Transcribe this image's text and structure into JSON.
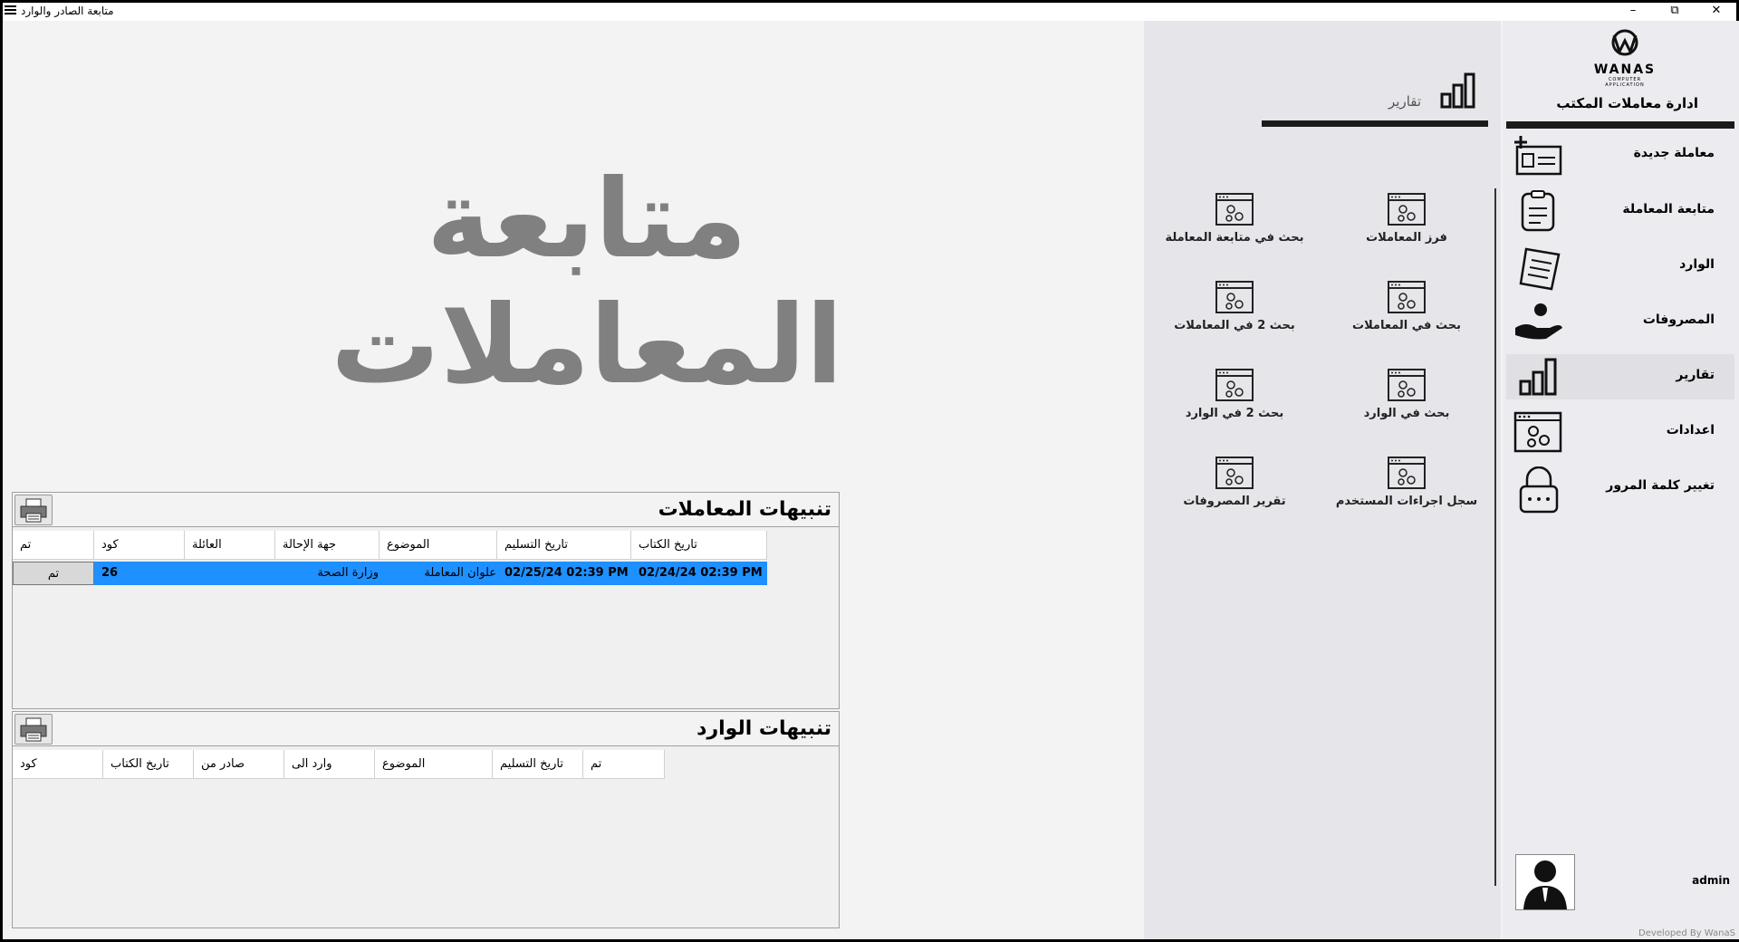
{
  "window": {
    "title": "متابعة الصادر والوارد",
    "minimize": "–",
    "restore": "⧉",
    "close": "✕"
  },
  "main": {
    "big_title": "متابعة المعاملات"
  },
  "transactions_panel": {
    "title": "تنبيهات المعاملات",
    "columns": [
      "تم",
      "كود",
      "العائلة",
      "جهة الإحالة",
      "الموضوع",
      "تاريخ التسليم",
      "تاريخ الكتاب"
    ],
    "rows": [
      {
        "done": "تم",
        "code": "26",
        "family": "",
        "referral": "وزارة الصحة",
        "subject": "علوان المعاملة",
        "delivery_date": "02/25/24 02:39 PM",
        "letter_date": "02/24/24 02:39 PM"
      }
    ]
  },
  "incoming_panel": {
    "title": "تنبيهات الوارد",
    "columns": [
      "كود",
      "تاريخ الكتاب",
      "صادر من",
      "وارد الى",
      "الموضوع",
      "تاريخ التسليم",
      "تم"
    ]
  },
  "reports": {
    "section_title": "تقارير",
    "section_icon": "bar-chart-icon",
    "tiles": [
      {
        "label": "فرز المعاملات",
        "icon": "settings-window-icon"
      },
      {
        "label": "بحث في متابعة المعاملة",
        "icon": "settings-window-icon"
      },
      {
        "label": "بحث في المعاملات",
        "icon": "settings-window-icon"
      },
      {
        "label": "بحث 2 في المعاملات",
        "icon": "settings-window-icon"
      },
      {
        "label": "بحث في الوارد",
        "icon": "settings-window-icon"
      },
      {
        "label": "بحث 2 في الوارد",
        "icon": "settings-window-icon"
      },
      {
        "label": "سجل اجراءات المستخدم",
        "icon": "settings-window-icon"
      },
      {
        "label": "تقرير المصروفات",
        "icon": "settings-window-icon"
      }
    ]
  },
  "sidebar": {
    "logo_text": "WANAS",
    "logo_sub": "COMPUTER APPLICATION",
    "app_title": "ادارة معاملات  المكتب",
    "items": [
      {
        "label": "معاملة جديدة",
        "icon": "new-card-icon"
      },
      {
        "label": "متابعة المعاملة",
        "icon": "clipboard-icon"
      },
      {
        "label": "الوارد",
        "icon": "scroll-icon"
      },
      {
        "label": "المصروفات",
        "icon": "money-hand-icon"
      },
      {
        "label": "تقارير",
        "icon": "bar-chart-icon"
      },
      {
        "label": "اعدادات",
        "icon": "settings-window-icon"
      },
      {
        "label": "تغيير كلمة المرور",
        "icon": "lock-icon"
      }
    ],
    "user": "admin",
    "developed_by": "Developed By WanaS"
  },
  "colors": {
    "selection": "#1e90ff",
    "big_title": "#808080",
    "side_panel": "#e6e6ea"
  }
}
